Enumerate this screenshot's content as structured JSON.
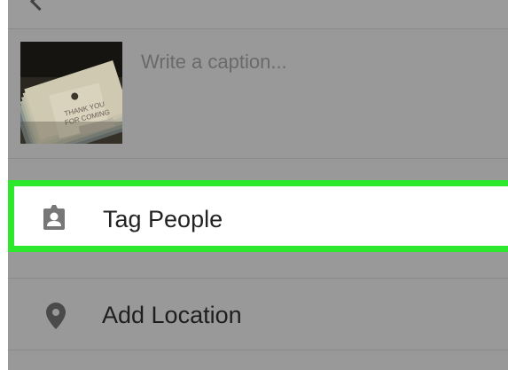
{
  "caption": {
    "placeholder": "Write a caption..."
  },
  "thumbnail": {
    "text_line1": "THANK YOU",
    "text_line2": "FOR COMING"
  },
  "options": {
    "tag_people_label": "Tag People",
    "add_location_label": "Add Location"
  },
  "colors": {
    "highlight": "#2ee82e",
    "overlay": "#999999"
  },
  "icons": {
    "tag_people": "person-badge-icon",
    "add_location": "map-pin-icon"
  }
}
